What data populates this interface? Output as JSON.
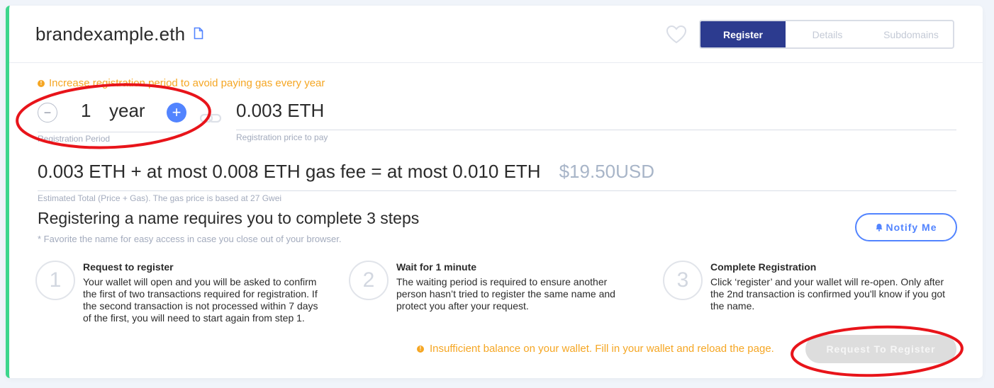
{
  "header": {
    "domain_name": "brandexample.eth",
    "tabs": [
      {
        "label": "Register",
        "active": true
      },
      {
        "label": "Details",
        "active": false
      },
      {
        "label": "Subdomains",
        "active": false
      }
    ]
  },
  "registration": {
    "warning": "Increase registration period to avoid paying gas every year",
    "period_value": "1",
    "period_unit": "year",
    "period_caption": "Registration Period",
    "price_value": "0.003 ETH",
    "price_caption": "Registration price to pay",
    "total_text": "0.003 ETH + at most 0.008 ETH gas fee = at most 0.010 ETH",
    "total_usd": "$19.50USD",
    "total_caption": "Estimated Total (Price + Gas). The gas price is based at 27 Gwei"
  },
  "steps": {
    "heading": "Registering a name requires you to complete 3 steps",
    "note": "* Favorite the name for easy access in case you close out of your browser.",
    "notify_label": "Notify Me",
    "items": [
      {
        "number": "1",
        "title": "Request to register",
        "text": "Your wallet will open and you will be asked to confirm the first of two transactions required for registration. If the second transaction is not processed within 7 days of the first, you will need to start again from step 1."
      },
      {
        "number": "2",
        "title": "Wait for 1 minute",
        "text": "The waiting period is required to ensure another person hasn’t tried to register the same name and protect you after your request."
      },
      {
        "number": "3",
        "title": "Complete Registration",
        "text": "Click ‘register’ and your wallet will re-open. Only after the 2nd transaction is confirmed you'll know if you got the name."
      }
    ]
  },
  "footer": {
    "warning": "Insufficient balance on your wallet. Fill in your wallet and reload the page.",
    "register_label": "Request To Register"
  },
  "colors": {
    "accent": "#5284ff",
    "tab_active": "#2c3b8f",
    "warning": "#f5a623",
    "left_border": "#3dd68c",
    "annotation": "#e8141a"
  },
  "icons": [
    "copy-icon",
    "heart-icon",
    "link-icon",
    "bell-icon",
    "warning-icon"
  ]
}
